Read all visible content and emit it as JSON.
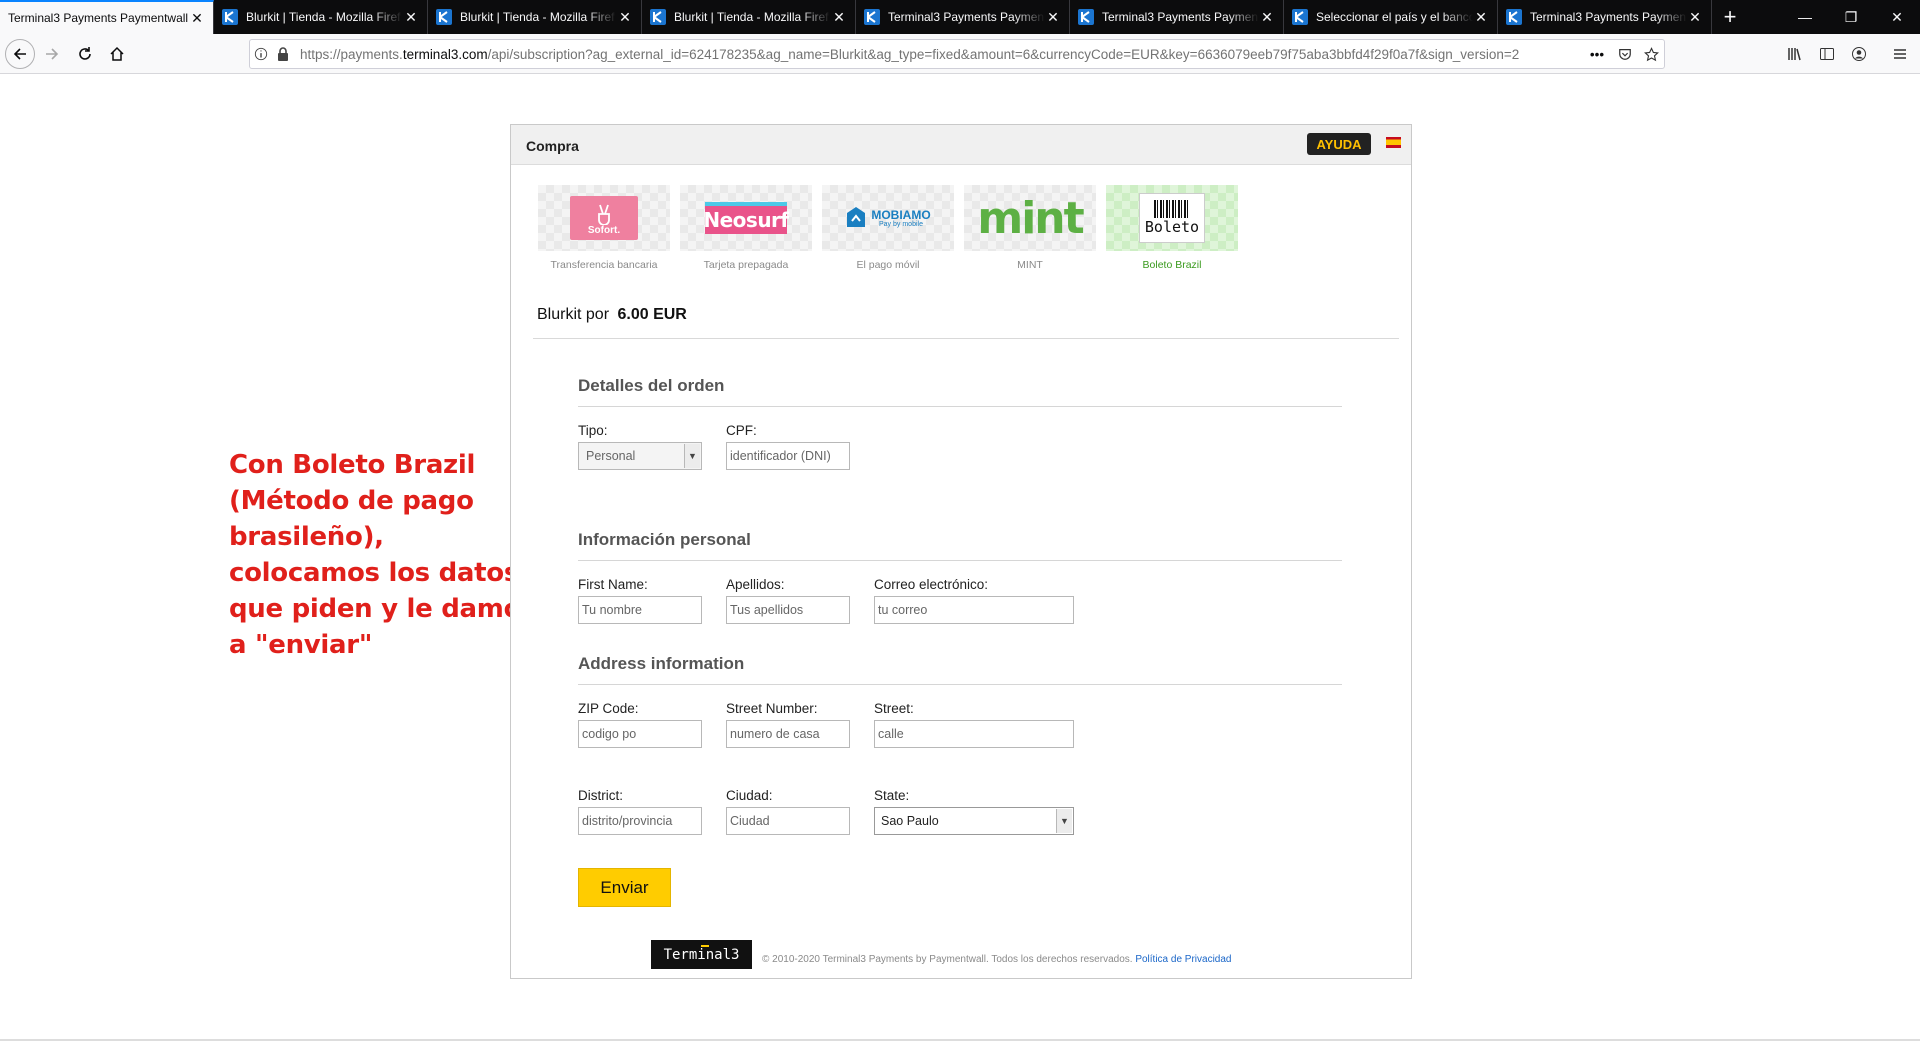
{
  "browser": {
    "tabs": [
      {
        "title": "Terminal3 Payments Paymentwall",
        "active": true,
        "icon": "paymentwall-favicon"
      },
      {
        "title": "Blurkit | Tienda - Mozilla Firef",
        "active": false,
        "icon": "blurkit-favicon"
      },
      {
        "title": "Blurkit | Tienda - Mozilla Firef",
        "active": false,
        "icon": "blurkit-favicon"
      },
      {
        "title": "Blurkit | Tienda - Mozilla Firef",
        "active": false,
        "icon": "blurkit-favicon"
      },
      {
        "title": "Terminal3 Payments Paymen",
        "active": false,
        "icon": "blurkit-favicon"
      },
      {
        "title": "Terminal3 Payments Paymen",
        "active": false,
        "icon": "blurkit-favicon"
      },
      {
        "title": "Seleccionar el país y el banco",
        "active": false,
        "icon": "blurkit-favicon"
      },
      {
        "title": "Terminal3 Payments Paymen",
        "active": false,
        "icon": "blurkit-favicon"
      }
    ],
    "new_tab": "+",
    "url_prefix": "https://payments.",
    "url_domain": "terminal3.com",
    "url_rest": "/api/subscription?ag_external_id=624178235&ag_name=Blurkit&ag_type=fixed&amount=6&currencyCode=EUR&key=6636079eeb79f75aba3bbfd4f29f0a7f&sign_version=2",
    "url_more": "•••",
    "accent": "#0a84ff"
  },
  "annotation": "Con Boleto Brazil (Método de pago brasileño), colocamos los datos que piden y le damos a \"enviar\"",
  "panel": {
    "title": "Compra",
    "help_label": "AYUDA",
    "methods": [
      {
        "label": "Transferencia bancaria",
        "logo": "Sofort.",
        "selected": false
      },
      {
        "label": "Tarjeta prepagada",
        "logo": "Neosurf",
        "selected": false
      },
      {
        "label": "El pago móvil",
        "logo": "MOBIAMO",
        "logo_sub": "Pay by mobile",
        "selected": false
      },
      {
        "label": "MINT",
        "logo": "mint",
        "selected": false
      },
      {
        "label": "Boleto Brazil",
        "logo": "Boleto",
        "selected": true
      }
    ],
    "product_prefix": "Blurkit por",
    "product_price": "6.00 EUR",
    "order_section": {
      "title": "Detalles del orden",
      "tipo_label": "Tipo:",
      "tipo_value": "Personal",
      "cpf_label": "CPF:",
      "cpf_placeholder": "identificador (DNI)"
    },
    "personal_section": {
      "title": "Información personal",
      "first_name_label": "First Name:",
      "first_name_placeholder": "Tu nombre",
      "last_name_label": "Apellidos:",
      "last_name_placeholder": "Tus apellidos",
      "email_label": "Correo electrónico:",
      "email_placeholder": "tu correo"
    },
    "address_section": {
      "title": "Address information",
      "zip_label": "ZIP Code:",
      "zip_placeholder": "codigo po",
      "street_number_label": "Street Number:",
      "street_number_placeholder": "numero de casa",
      "street_label": "Street:",
      "street_placeholder": "calle",
      "district_label": "District:",
      "district_placeholder": "distrito/provincia",
      "city_label": "Ciudad:",
      "city_placeholder": "Ciudad",
      "state_label": "State:",
      "state_value": "Sao Paulo"
    },
    "submit_label": "Enviar",
    "footer": {
      "logo_text": "Terminal3",
      "copyright": "© 2010-2020 Terminal3 Payments by Paymentwall. Todos los derechos reservados.",
      "privacy_link": "Política de Privacidad"
    }
  }
}
